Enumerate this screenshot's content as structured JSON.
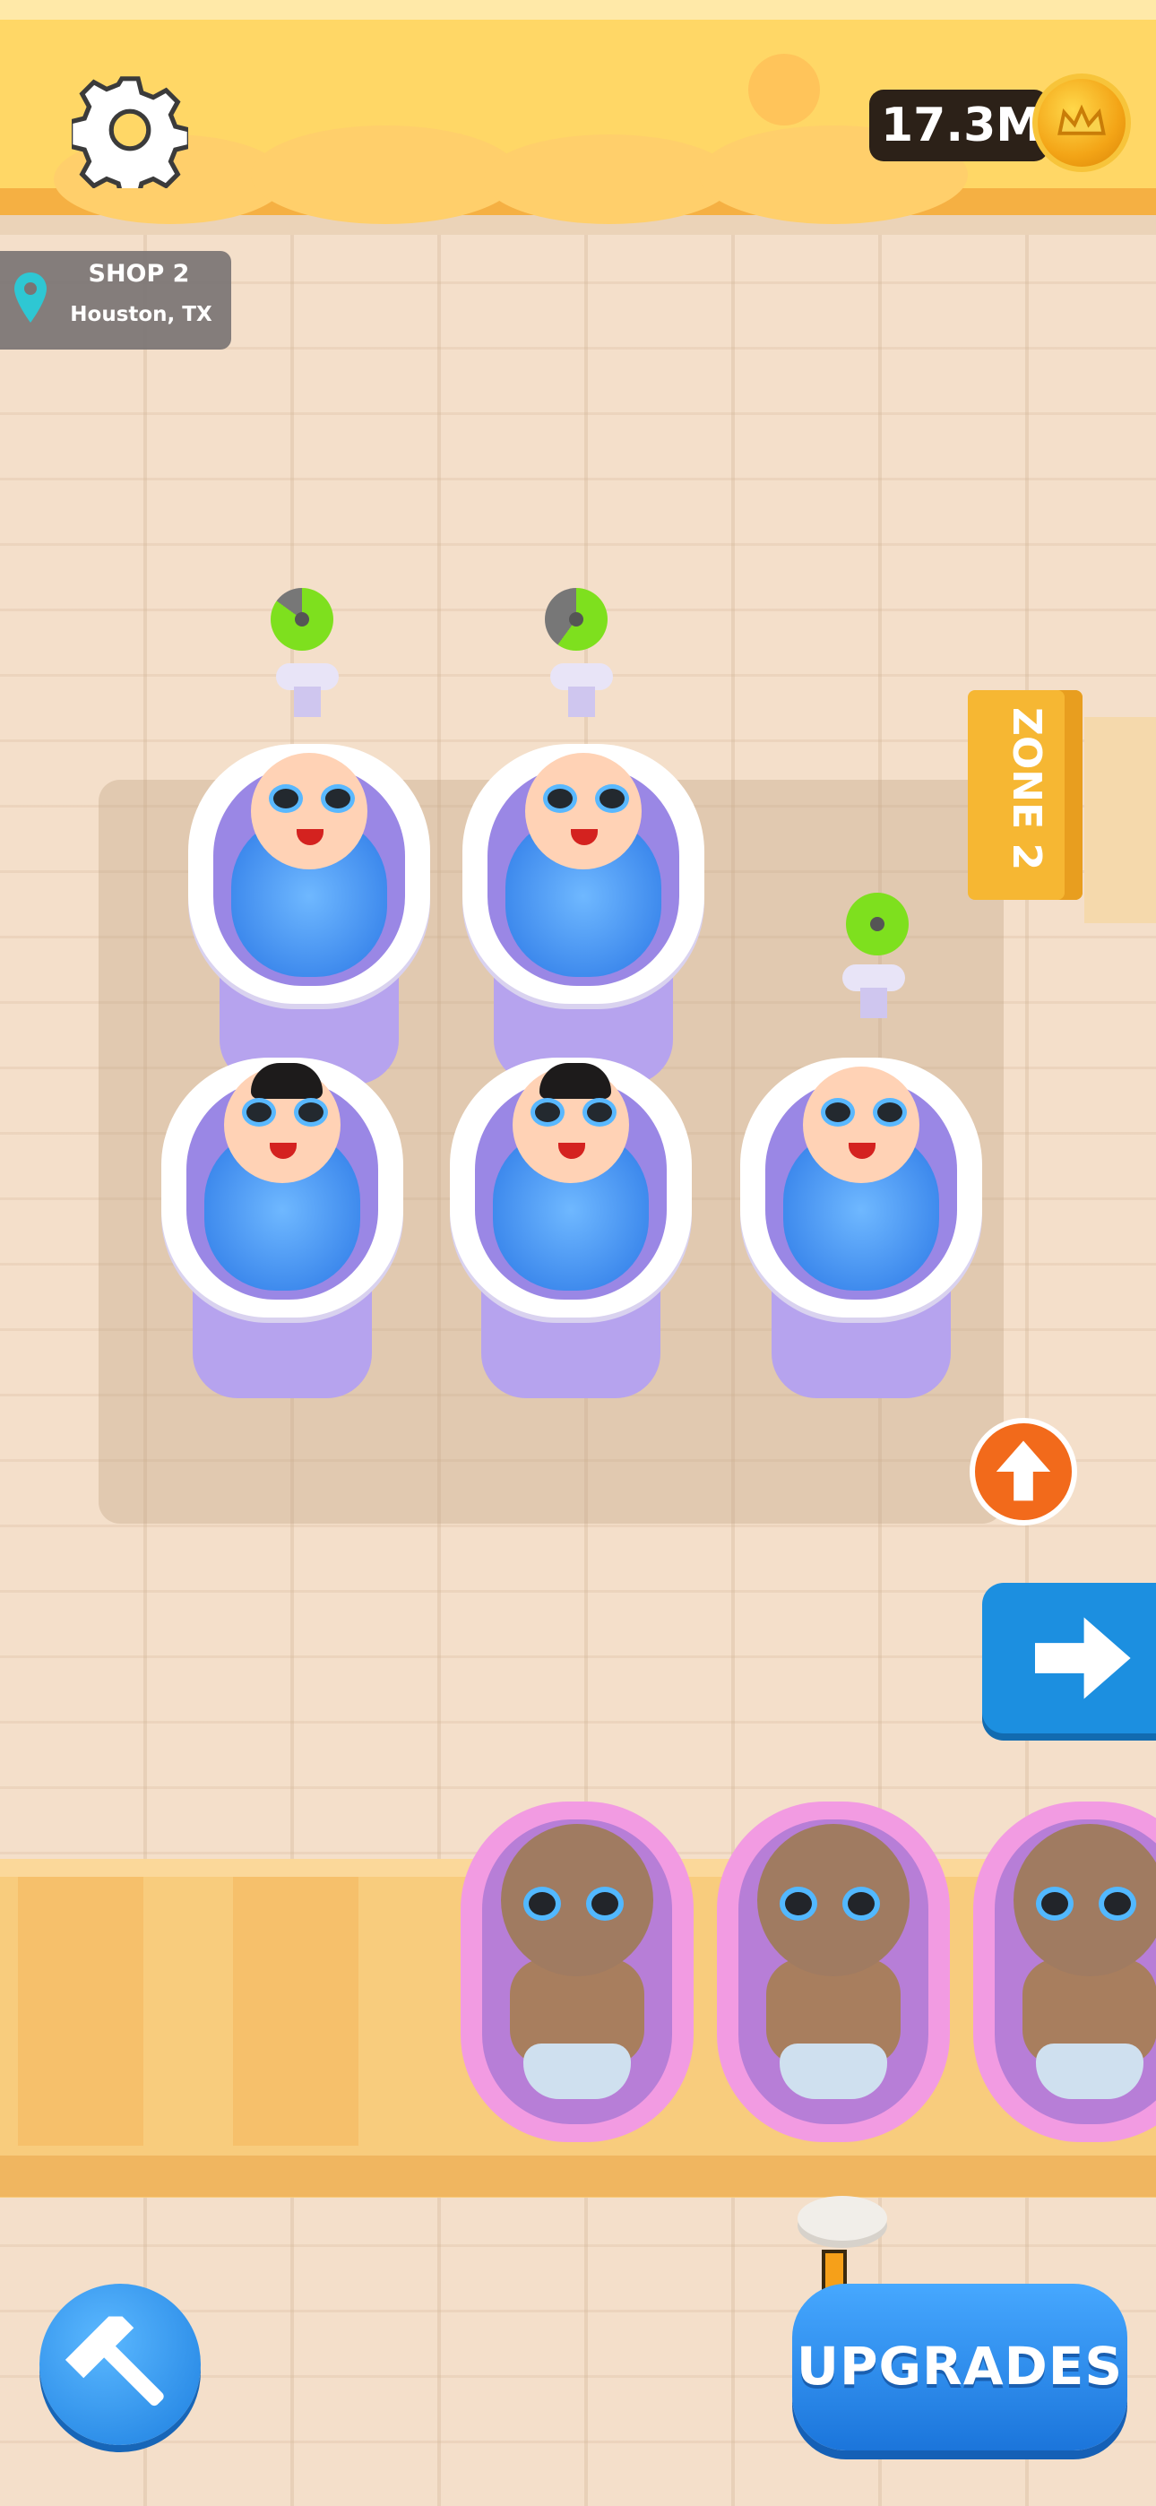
{
  "hud": {
    "currency": "17.3M"
  },
  "location": {
    "title": "SHOP 2",
    "subtitle": "Houston, TX"
  },
  "zone_sign": "ZONE 2",
  "buttons": {
    "upgrades": "UPGRADES"
  },
  "icons": {
    "settings": "gear-icon",
    "coin": "crown-coin-icon",
    "location": "map-pin-icon",
    "build": "hammer-icon",
    "up": "arrow-up-icon",
    "next": "arrow-right-icon",
    "alert": "exclamation-icon"
  },
  "timers": [
    {
      "progress": 0.85
    },
    {
      "progress": 0.6
    },
    {
      "progress": 1.0
    }
  ],
  "colors": {
    "top_bar": "#ffd766",
    "accent_blue": "#1c8fe0",
    "accent_orange": "#f26a1b",
    "timer_green": "#7ee01e"
  }
}
